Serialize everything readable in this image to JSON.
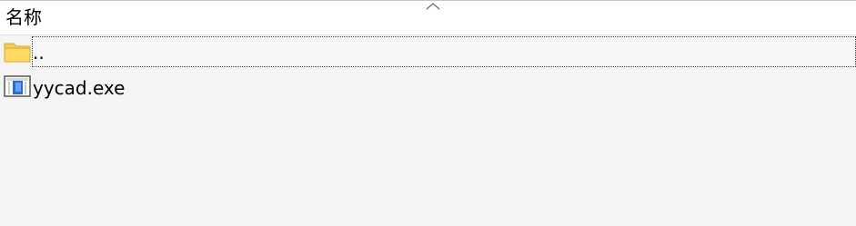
{
  "columns": {
    "name_label": "名称",
    "sort_icon": "chevron-up-icon"
  },
  "rows": [
    {
      "label": "..",
      "icon": "folder-icon",
      "focused": true
    },
    {
      "label": "yycad.exe",
      "icon": "application-icon",
      "focused": false
    }
  ],
  "colors": {
    "header_background": "#ffffff",
    "panel_background": "#f4f4f4",
    "folder_yellow": "#f5c84c",
    "exe_blue": "#2d6bd6"
  }
}
